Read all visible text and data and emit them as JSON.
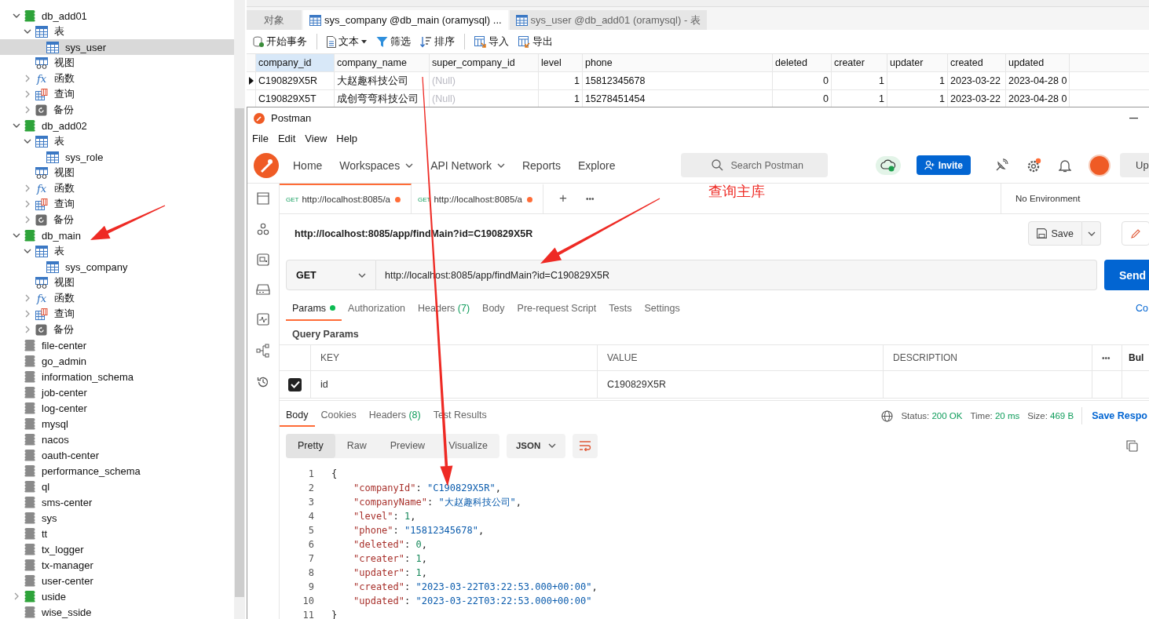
{
  "tree": [
    {
      "kind": "database",
      "label": "db_add01",
      "open": true,
      "expanded": true,
      "selected": false,
      "children": [
        {
          "kind": "tables",
          "label": "表",
          "expanded": true,
          "selected": false,
          "children": [
            {
              "kind": "table",
              "label": "sys_user",
              "selected": true
            }
          ]
        },
        {
          "kind": "views",
          "label": "视图",
          "selected": false
        },
        {
          "kind": "functions",
          "icon": "fx",
          "label": "函数",
          "expanded": false,
          "selected": false
        },
        {
          "kind": "queries",
          "label": "查询",
          "expanded": false,
          "selected": false
        },
        {
          "kind": "backups",
          "label": "备份",
          "expanded": false,
          "selected": false
        }
      ]
    },
    {
      "kind": "database",
      "label": "db_add02",
      "open": true,
      "expanded": true,
      "selected": false,
      "children": [
        {
          "kind": "tables",
          "label": "表",
          "expanded": true,
          "selected": false,
          "children": [
            {
              "kind": "table",
              "label": "sys_role",
              "selected": false
            }
          ]
        },
        {
          "kind": "views",
          "label": "视图",
          "selected": false
        },
        {
          "kind": "functions",
          "icon": "fx",
          "label": "函数",
          "expanded": false,
          "selected": false
        },
        {
          "kind": "queries",
          "label": "查询",
          "expanded": false,
          "selected": false
        },
        {
          "kind": "backups",
          "label": "备份",
          "expanded": false,
          "selected": false
        }
      ]
    },
    {
      "kind": "database",
      "label": "db_main",
      "open": true,
      "expanded": true,
      "selected": false,
      "children": [
        {
          "kind": "tables",
          "label": "表",
          "expanded": true,
          "selected": false,
          "children": [
            {
              "kind": "table",
              "label": "sys_company",
              "selected": false
            }
          ]
        },
        {
          "kind": "views",
          "label": "视图",
          "selected": false
        },
        {
          "kind": "functions",
          "icon": "fx",
          "label": "函数",
          "expanded": false,
          "selected": false
        },
        {
          "kind": "queries",
          "label": "查询",
          "expanded": false,
          "selected": false
        },
        {
          "kind": "backups",
          "label": "备份",
          "expanded": false,
          "selected": false
        }
      ]
    },
    {
      "kind": "database",
      "label": "file-center",
      "open": false,
      "selected": false
    },
    {
      "kind": "database",
      "label": "go_admin",
      "open": false,
      "selected": false
    },
    {
      "kind": "database",
      "label": "information_schema",
      "open": false,
      "selected": false
    },
    {
      "kind": "database",
      "label": "job-center",
      "open": false,
      "selected": false
    },
    {
      "kind": "database",
      "label": "log-center",
      "open": false,
      "selected": false
    },
    {
      "kind": "database",
      "label": "mysql",
      "open": false,
      "selected": false
    },
    {
      "kind": "database",
      "label": "nacos",
      "open": false,
      "selected": false
    },
    {
      "kind": "database",
      "label": "oauth-center",
      "open": false,
      "selected": false
    },
    {
      "kind": "database",
      "label": "performance_schema",
      "open": false,
      "selected": false
    },
    {
      "kind": "database",
      "label": "ql",
      "open": false,
      "selected": false
    },
    {
      "kind": "database",
      "label": "sms-center",
      "open": false,
      "selected": false
    },
    {
      "kind": "database",
      "label": "sys",
      "open": false,
      "selected": false
    },
    {
      "kind": "database",
      "label": "tt",
      "open": false,
      "selected": false
    },
    {
      "kind": "database",
      "label": "tx_logger",
      "open": false,
      "selected": false
    },
    {
      "kind": "database",
      "label": "tx-manager",
      "open": false,
      "selected": false
    },
    {
      "kind": "database",
      "label": "user-center",
      "open": false,
      "selected": false
    },
    {
      "kind": "database",
      "label": "uside",
      "open": true,
      "expanded": false,
      "selected": false
    },
    {
      "kind": "database",
      "label": "wise_sside",
      "open": false,
      "selected": false
    }
  ],
  "navicat": {
    "tabs": [
      {
        "label": "对象",
        "kind": "objects",
        "selected": false
      },
      {
        "label": "sys_company @db_main (oramysql) ...",
        "kind": "table",
        "selected": true
      },
      {
        "label": "sys_user @db_add01 (oramysql) - 表",
        "kind": "table",
        "selected": false
      }
    ],
    "toolbar": [
      {
        "kind": "transaction",
        "label": "开始事务"
      },
      {
        "kind": "separator"
      },
      {
        "kind": "text",
        "label": "文本",
        "dropdown": true
      },
      {
        "kind": "filter",
        "label": "筛选"
      },
      {
        "kind": "sort",
        "label": "排序"
      },
      {
        "kind": "separator"
      },
      {
        "kind": "import",
        "label": "导入"
      },
      {
        "kind": "export",
        "label": "导出"
      }
    ],
    "columns": [
      {
        "label": "company_id",
        "kind": "text",
        "selected": true
      },
      {
        "label": "company_name",
        "kind": "text",
        "selected": false
      },
      {
        "label": "super_company_id",
        "kind": "text",
        "selected": false
      },
      {
        "label": "level",
        "kind": "number",
        "selected": false
      },
      {
        "label": "phone",
        "kind": "text",
        "selected": false
      },
      {
        "label": "deleted",
        "kind": "number",
        "selected": false
      },
      {
        "label": "creater",
        "kind": "number",
        "selected": false
      },
      {
        "label": "updater",
        "kind": "number",
        "selected": false
      },
      {
        "label": "created",
        "kind": "text",
        "selected": false
      },
      {
        "label": "updated",
        "kind": "text",
        "selected": false
      }
    ],
    "rows": [
      {
        "selected": true,
        "cells": [
          "C190829X5R",
          "大赵趣科技公司",
          {
            "text": "(Null)",
            "kind": "null"
          },
          "1",
          "15812345678",
          "0",
          "1",
          "1",
          "2023-03-22",
          "2023-04-28 0"
        ]
      },
      {
        "selected": false,
        "cells": [
          "C190829X5T",
          "成创弯弯科技公司",
          {
            "text": "(Null)",
            "kind": "null"
          },
          "1",
          "15278451454",
          "0",
          "1",
          "1",
          "2023-03-22",
          "2023-04-28 0"
        ]
      }
    ]
  },
  "postman": {
    "window": {
      "title": "Postman"
    },
    "menu": [
      "File",
      "Edit",
      "View",
      "Help"
    ],
    "nav": [
      {
        "label": "Home",
        "dropdown": false
      },
      {
        "label": "Workspaces",
        "dropdown": true
      },
      {
        "label": "API Network",
        "dropdown": true
      },
      {
        "label": "Reports",
        "dropdown": false
      },
      {
        "label": "Explore",
        "dropdown": false
      }
    ],
    "search": {
      "placeholder": "Search Postman"
    },
    "invite": "Invite",
    "upgrade": "Up",
    "tabs": [
      {
        "method": "GET",
        "label": "http://localhost:8085/a",
        "unsaved": true,
        "selected": true
      },
      {
        "method": "GET",
        "label": "http://localhost:8085/a",
        "unsaved": true,
        "selected": false
      }
    ],
    "tab_add": "+",
    "tab_more": "•••",
    "environment": "No Environment",
    "request_name": "http://localhost:8085/app/findMain?id=C190829X5R",
    "save": "Save",
    "method": "GET",
    "url": "http://localhost:8085/app/findMain?id=C190829X5R",
    "send": "Send",
    "request_tabs": [
      {
        "label": "Params",
        "dot": true,
        "selected": true
      },
      {
        "label": "Authorization",
        "dot": false,
        "selected": false
      },
      {
        "label": "Headers",
        "count": "(7)",
        "dot": false,
        "selected": false
      },
      {
        "label": "Body",
        "dot": false,
        "selected": false
      },
      {
        "label": "Pre-request Script",
        "dot": false,
        "selected": false
      },
      {
        "label": "Tests",
        "dot": false,
        "selected": false
      },
      {
        "label": "Settings",
        "dot": false,
        "selected": false
      }
    ],
    "cookies_link": "Co",
    "query_params_title": "Query Params",
    "params_columns": [
      "KEY",
      "VALUE",
      "DESCRIPTION",
      "•••",
      "Bul"
    ],
    "params": [
      {
        "checked": true,
        "key": "id",
        "value": "C190829X5R"
      }
    ],
    "response_tabs": [
      {
        "label": "Body",
        "selected": true
      },
      {
        "label": "Cookies",
        "selected": false
      },
      {
        "label": "Headers",
        "count": "(8)",
        "selected": false
      },
      {
        "label": "Test Results",
        "selected": false
      }
    ],
    "status": [
      {
        "label": "Status:",
        "value": "200 OK"
      },
      {
        "label": "Time:",
        "value": "20 ms"
      },
      {
        "label": "Size:",
        "value": "469 B"
      }
    ],
    "save_response": "Save Respo",
    "views": [
      {
        "label": "Pretty",
        "selected": true
      },
      {
        "label": "Raw",
        "selected": false
      },
      {
        "label": "Preview",
        "selected": false
      },
      {
        "label": "Visualize",
        "selected": false
      }
    ],
    "format": "JSON",
    "code": [
      {
        "number": "1",
        "parts": [
          {
            "text": "{",
            "kind": "punct"
          }
        ],
        "children": [
          {
            "number": "2",
            "parts": [
              {
                "text": "\"companyId\"",
                "kind": "key"
              },
              {
                "text": ": ",
                "kind": "punct"
              },
              {
                "text": "\"C190829X5R\"",
                "kind": "string"
              },
              {
                "text": ",",
                "kind": "punct"
              }
            ]
          },
          {
            "number": "3",
            "parts": [
              {
                "text": "\"companyName\"",
                "kind": "key"
              },
              {
                "text": ": ",
                "kind": "punct"
              },
              {
                "text": "\"大赵趣科技公司\"",
                "kind": "string"
              },
              {
                "text": ",",
                "kind": "punct"
              }
            ]
          },
          {
            "number": "4",
            "parts": [
              {
                "text": "\"level\"",
                "kind": "key"
              },
              {
                "text": ": ",
                "kind": "punct"
              },
              {
                "text": "1",
                "kind": "number"
              },
              {
                "text": ",",
                "kind": "punct"
              }
            ]
          },
          {
            "number": "5",
            "parts": [
              {
                "text": "\"phone\"",
                "kind": "key"
              },
              {
                "text": ": ",
                "kind": "punct"
              },
              {
                "text": "\"15812345678\"",
                "kind": "string"
              },
              {
                "text": ",",
                "kind": "punct"
              }
            ]
          },
          {
            "number": "6",
            "parts": [
              {
                "text": "\"deleted\"",
                "kind": "key"
              },
              {
                "text": ": ",
                "kind": "punct"
              },
              {
                "text": "0",
                "kind": "number"
              },
              {
                "text": ",",
                "kind": "punct"
              }
            ]
          },
          {
            "number": "7",
            "parts": [
              {
                "text": "\"creater\"",
                "kind": "key"
              },
              {
                "text": ": ",
                "kind": "punct"
              },
              {
                "text": "1",
                "kind": "number"
              },
              {
                "text": ",",
                "kind": "punct"
              }
            ]
          },
          {
            "number": "8",
            "parts": [
              {
                "text": "\"updater\"",
                "kind": "key"
              },
              {
                "text": ": ",
                "kind": "punct"
              },
              {
                "text": "1",
                "kind": "number"
              },
              {
                "text": ",",
                "kind": "punct"
              }
            ]
          },
          {
            "number": "9",
            "parts": [
              {
                "text": "\"created\"",
                "kind": "key"
              },
              {
                "text": ": ",
                "kind": "punct"
              },
              {
                "text": "\"2023-03-22T03:22:53.000+00:00\"",
                "kind": "string"
              },
              {
                "text": ",",
                "kind": "punct"
              }
            ]
          },
          {
            "number": "10",
            "parts": [
              {
                "text": "\"updated\"",
                "kind": "key"
              },
              {
                "text": ": ",
                "kind": "punct"
              },
              {
                "text": "\"2023-03-22T03:22:53.000+00:00\"",
                "kind": "string"
              }
            ]
          }
        ]
      },
      {
        "number": "11",
        "parts": [
          {
            "text": "}",
            "kind": "punct"
          }
        ]
      }
    ]
  },
  "annotation": {
    "label": "查询主库"
  }
}
